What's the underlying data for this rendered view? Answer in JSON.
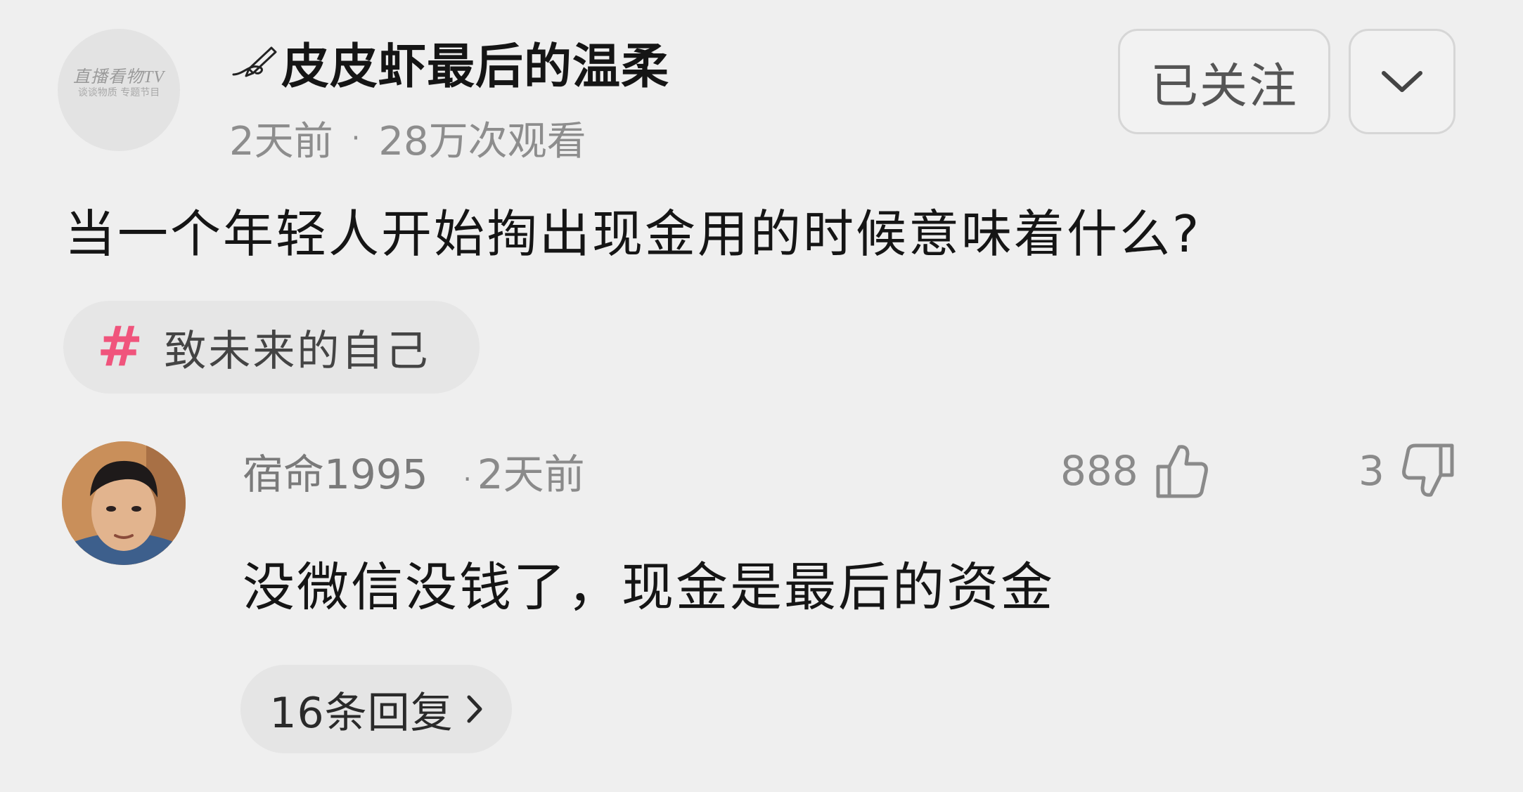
{
  "post": {
    "channel_logo_text": "直播看物TV",
    "channel_logo_sub": "谈谈物质 专题节目",
    "channel_name": "皮皮虾最后的温柔",
    "age": "2天前",
    "separator": "·",
    "views": "28万次观看",
    "follow_label": "已关注",
    "question": "当一个年轻人开始掏出现金用的时候意味着什么?",
    "topic_hash": "#",
    "topic_label": "致未来的自己"
  },
  "comment": {
    "username": "宿命1995",
    "separator": "·",
    "time": "2天前",
    "likes": "888",
    "dislikes": "3",
    "text": "没微信没钱了，现金是最后的资金",
    "replies_label": "16条回复"
  },
  "colors": {
    "background": "#efefef",
    "accent_hash": "#f0547c",
    "meta_text": "#8d8d8d"
  },
  "icons": [
    "pen-icon",
    "chevron-down-icon",
    "thumbs-up-icon",
    "thumbs-down-icon",
    "chevron-right-icon"
  ]
}
